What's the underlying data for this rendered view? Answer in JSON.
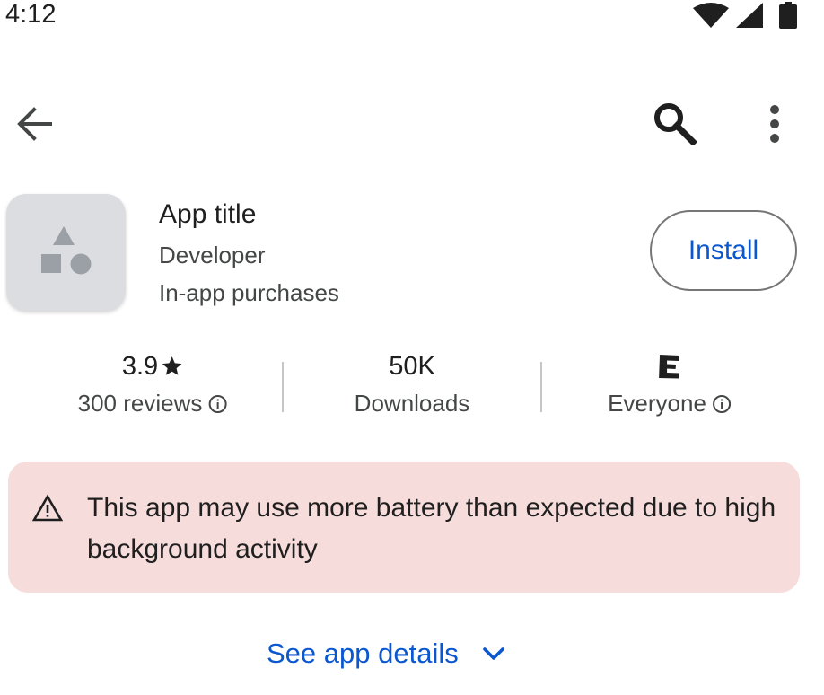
{
  "status_bar": {
    "time": "4:12",
    "icons": [
      "wifi-icon",
      "cellular-signal-icon",
      "battery-icon"
    ]
  },
  "top_bar": {
    "icons": [
      "back-arrow-icon",
      "search-icon",
      "more-vert-icon"
    ]
  },
  "app": {
    "title": "App title",
    "developer": "Developer",
    "purchases": "In-app purchases",
    "install_label": "Install",
    "icon": "app-placeholder-shapes-icon"
  },
  "stats": {
    "rating": "3.9",
    "reviews": "300 reviews",
    "downloads_value": "50K",
    "downloads_label": "Downloads",
    "content_rating_label": "Everyone"
  },
  "warning": {
    "text": "This app may use more battery than expected due to high background activity",
    "icon": "warning-triangle-icon"
  },
  "details": {
    "label": "See app details",
    "icon": "chevron-down-icon"
  },
  "colors": {
    "accent": "#0b57d0",
    "warning_bg": "#f6dcdb",
    "icon_bg": "#dcdde0"
  }
}
